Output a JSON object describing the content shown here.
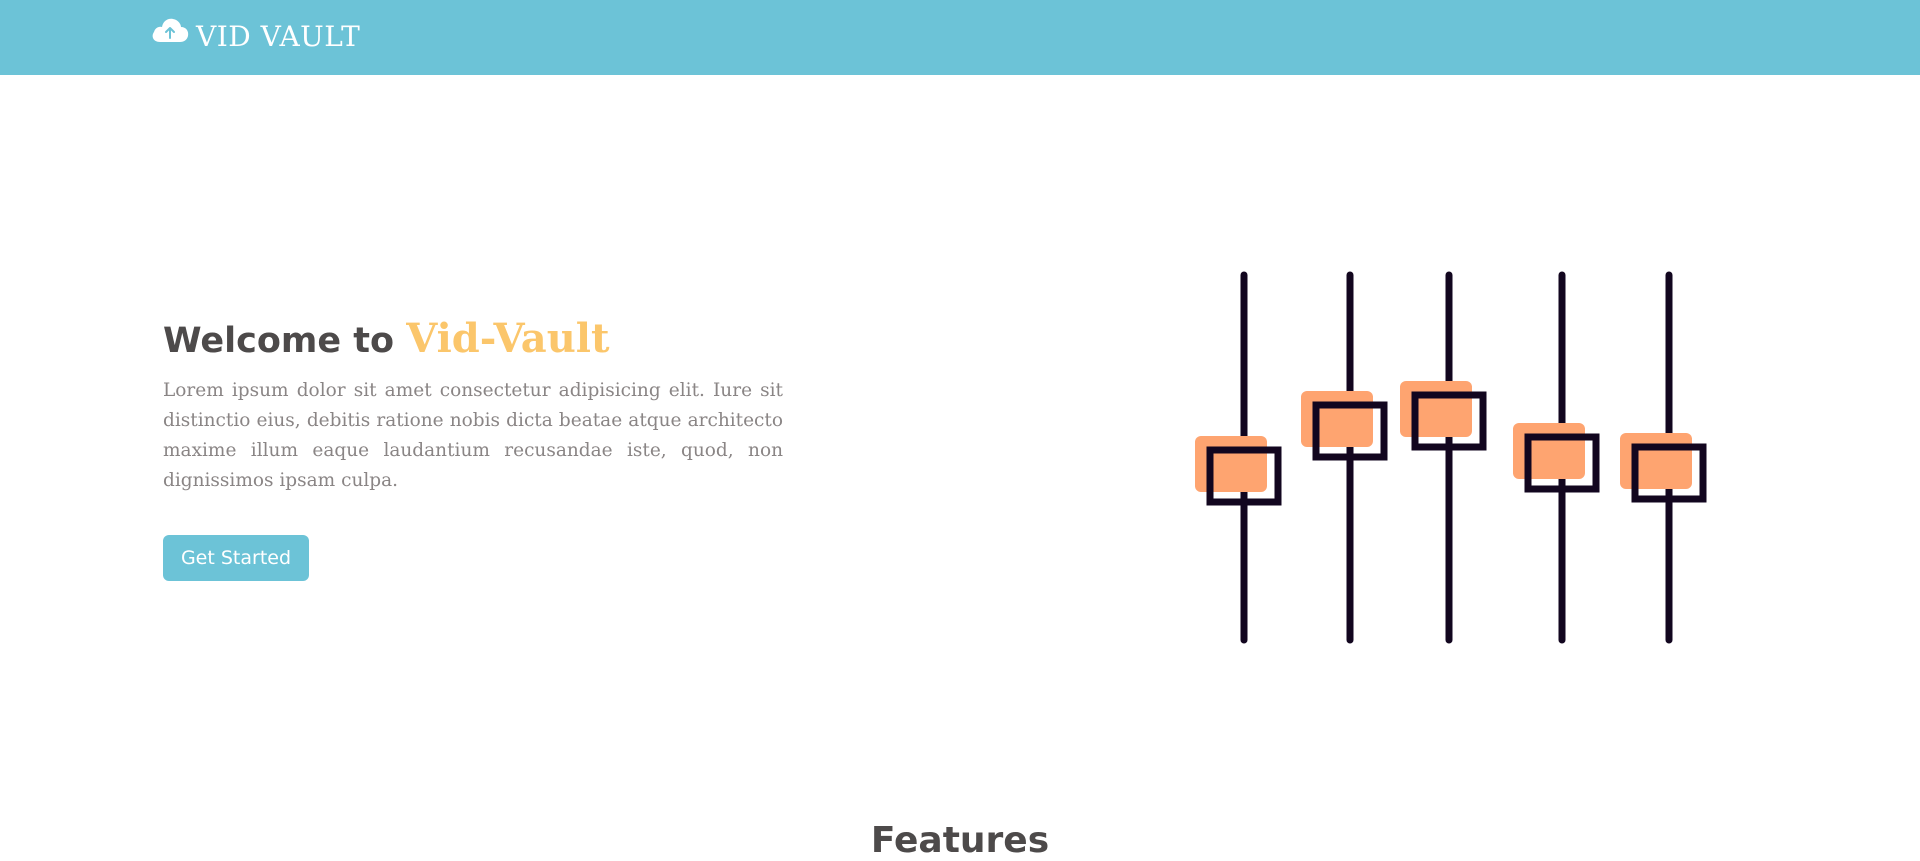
{
  "brand": {
    "name": "VID VAULT",
    "icon": "cloud-upload-icon"
  },
  "hero": {
    "title_prefix": "Welcome to ",
    "title_accent": "Vid-Vault",
    "description": "Lorem ipsum dolor sit amet consectetur adipisicing elit. Iure sit distinctio eius, debitis ratione nobis dicta beatae atque architecto maxime illum eaque laudantium recusandae iste, quod, non dignissimos ipsam culpa.",
    "cta_label": "Get Started",
    "illustration_icon": "equalizer-sliders-icon"
  },
  "sections": {
    "features_title": "Features"
  },
  "colors": {
    "primary": "#6cc3d7",
    "accent": "#fbc66b",
    "text": "#4d4a4a",
    "muted": "#8a8585",
    "slider_fill": "#fea470",
    "slider_stroke": "#12061f"
  }
}
